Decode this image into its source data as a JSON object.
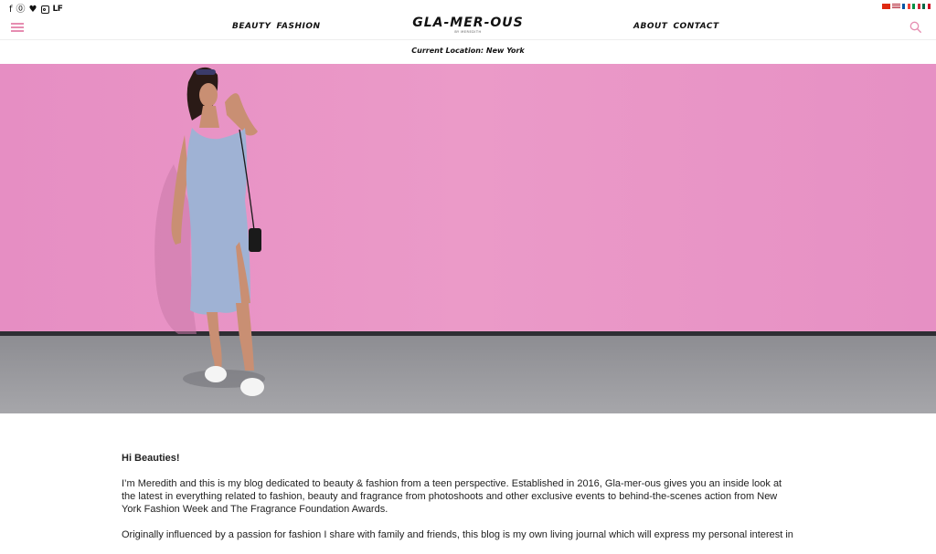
{
  "header": {
    "social": {
      "facebook": "f",
      "pinterest": "℗",
      "twitter": "🐦",
      "lf": "LF"
    },
    "nav_left": [
      "BEAUTY",
      "FASHION"
    ],
    "nav_right": [
      "ABOUT",
      "CONTACT"
    ],
    "logo": "GLA-MER-OUS",
    "logo_sub": "BY MEREDITH",
    "location": "Current Location: New York",
    "flags": [
      "cn",
      "us",
      "fr",
      "it",
      "mx"
    ],
    "accent": "#e68db1"
  },
  "hero": {
    "wall_color": "#e894c4",
    "sidewalk_color": "#9a9a9e"
  },
  "article": {
    "greeting": "Hi Beauties!",
    "paragraph_1": "I’m Meredith and this is my blog dedicated to beauty & fashion from a teen perspective. Established in 2016, Gla-mer-ous gives you an inside look at the latest in everything related to fashion, beauty and fragrance from photoshoots and other exclusive events to behind-the-scenes action from New York Fashion Week and The Fragrance Foundation Awards.",
    "paragraph_2": "Originally influenced by a passion for fashion I share with family and friends, this blog is my own living journal which will express my personal interest in"
  }
}
